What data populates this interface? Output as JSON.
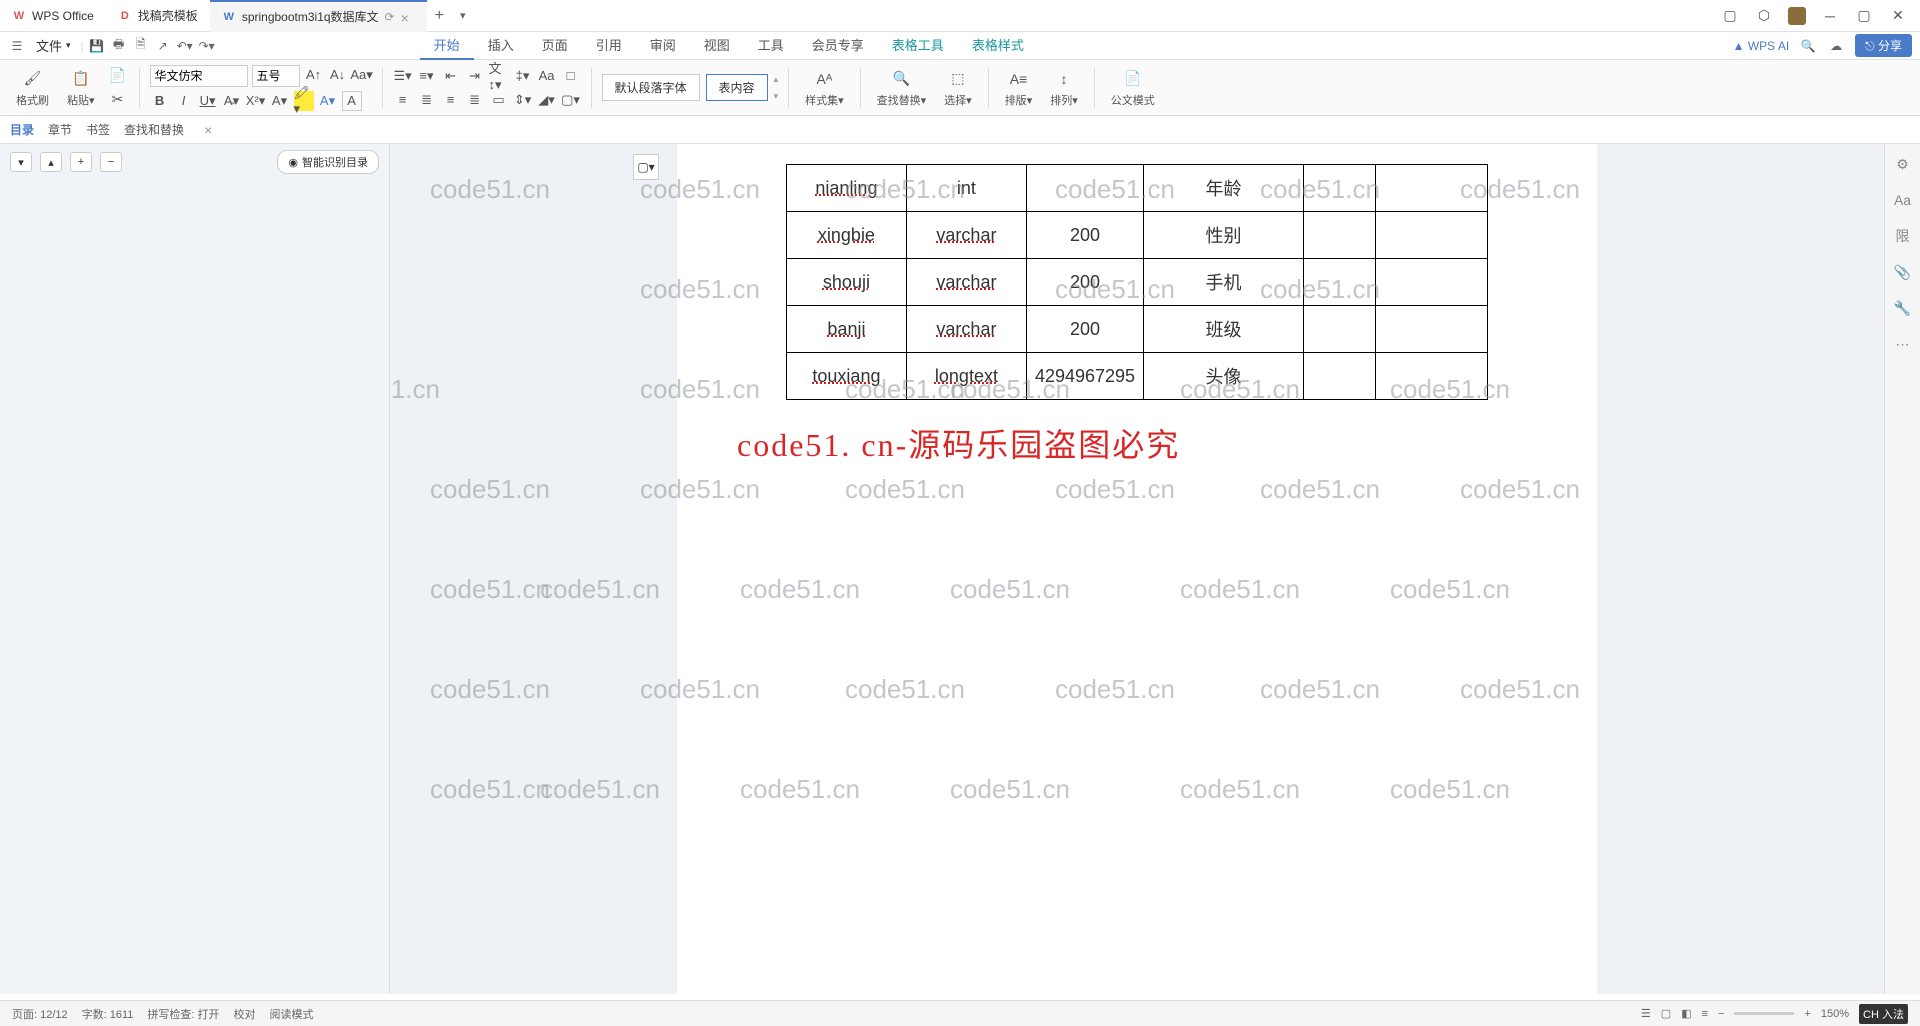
{
  "tabs": [
    {
      "icon": "W",
      "iconColor": "#d9534f",
      "label": "WPS Office"
    },
    {
      "icon": "D",
      "iconColor": "#d9534f",
      "label": "找稿壳模板"
    },
    {
      "icon": "W",
      "iconColor": "#4a7bc8",
      "label": "springbootm3i1q数据库文"
    }
  ],
  "menu": {
    "file": "文件",
    "tabs": [
      "开始",
      "插入",
      "页面",
      "引用",
      "审阅",
      "视图",
      "工具",
      "会员专享"
    ],
    "tableTools": "表格工具",
    "tableStyle": "表格样式",
    "wpsAi": "WPS AI",
    "share": "分享"
  },
  "ribbon": {
    "formatPainter": "格式刷",
    "paste": "粘贴",
    "fontName": "华文仿宋",
    "fontSize": "五号",
    "defaultParaFont": "默认段落字体",
    "tableContent": "表内容",
    "styleSet": "样式集",
    "findReplace": "查找替换",
    "select": "选择",
    "arrange": "排版",
    "sort": "排列",
    "officeMode": "公文模式"
  },
  "navPanel": {
    "tabs": [
      "目录",
      "章节",
      "书签",
      "查找和替换"
    ],
    "smartToc": "智能识别目录"
  },
  "tableData": {
    "rows": [
      {
        "field": "nianling",
        "type": "int",
        "len": "",
        "desc": "年龄"
      },
      {
        "field": "xingbie",
        "type": "varchar",
        "len": "200",
        "desc": "性别"
      },
      {
        "field": "shouji",
        "type": "varchar",
        "len": "200",
        "desc": "手机"
      },
      {
        "field": "banji",
        "type": "varchar",
        "len": "200",
        "desc": "班级"
      },
      {
        "field": "touxiang",
        "type": "longtext",
        "len": "4294967295",
        "desc": "头像"
      }
    ]
  },
  "watermarkTextLine": "code51. cn-源码乐园盗图必究",
  "watermark": "code51.cn",
  "statusBar": {
    "page": "页面: 12/12",
    "words": "字数: 1611",
    "spell": "拼写检查: 打开",
    "proof": "校对",
    "readMode": "阅读模式",
    "zoom": "150%",
    "ime": "CH 入法"
  }
}
